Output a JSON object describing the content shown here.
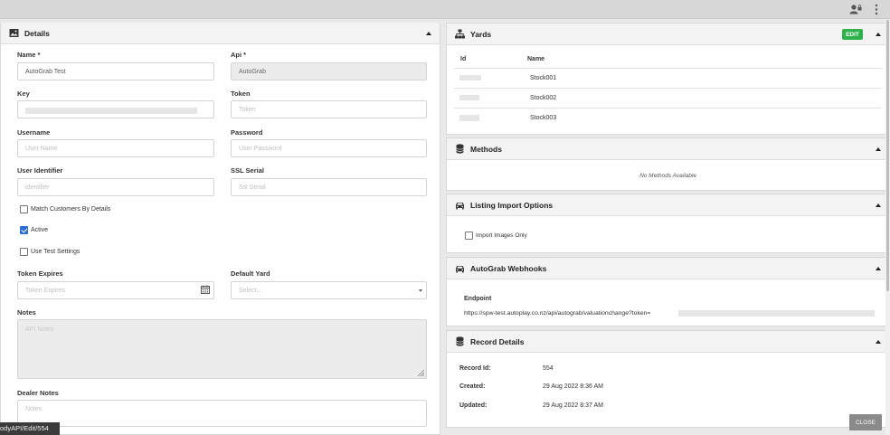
{
  "details": {
    "title": "Details",
    "name_label": "Name *",
    "name_value": "AutoGrab Test",
    "api_label": "Api *",
    "api_value": "AutoGrab",
    "key_label": "Key",
    "token_label": "Token",
    "token_placeholder": "Token",
    "username_label": "Username",
    "username_placeholder": "User Name",
    "password_label": "Password",
    "password_placeholder": "User Password",
    "user_identifier_label": "User Identifier",
    "user_identifier_placeholder": "identifier",
    "ssl_serial_label": "SSL Serial",
    "ssl_serial_placeholder": "Ssl Serial",
    "match_customers_label": "Match Customers By Details",
    "match_customers_checked": false,
    "active_label": "Active",
    "active_checked": true,
    "use_test_label": "Use Test Settings",
    "use_test_checked": false,
    "token_expires_label": "Token Expires",
    "token_expires_placeholder": "Token Expires",
    "default_yard_label": "Default Yard",
    "default_yard_placeholder": "Select...",
    "notes_label": "Notes",
    "notes_placeholder": "API Notes",
    "dealer_notes_label": "Dealer Notes",
    "dealer_notes_placeholder": "Notes"
  },
  "yards": {
    "title": "Yards",
    "edit_label": "EDIT",
    "col_id": "Id",
    "col_name": "Name",
    "rows": [
      {
        "name": "Stock001"
      },
      {
        "name": "Stock002"
      },
      {
        "name": "Stock003"
      }
    ]
  },
  "methods": {
    "title": "Methods",
    "empty": "No Methods Available"
  },
  "listing": {
    "title": "Listing Import Options",
    "import_images_label": "Import Images Only",
    "import_images_checked": false
  },
  "webhooks": {
    "title": "AutoGrab Webhooks",
    "endpoint_label": "Endpoint",
    "endpoint_value": "https://spw-test.autoplay.co.nz/api/autograb/valuationchange?token="
  },
  "record": {
    "title": "Record Details",
    "id_label": "Record Id:",
    "id_value": "554",
    "created_label": "Created:",
    "created_value": "29 Aug 2022 8:36 AM",
    "updated_label": "Updated:",
    "updated_value": "29 Aug 2022 8:37 AM"
  },
  "close_label": "CLOSE",
  "status_url": "odyAPI/Edit/554",
  "colors": {
    "accent": "#2b6fd6",
    "edit_green": "#2fb24c",
    "close_gray": "#8a8a8a"
  }
}
